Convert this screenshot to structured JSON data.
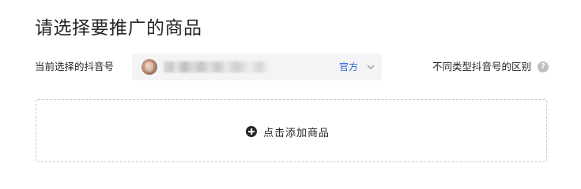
{
  "page": {
    "title": "请选择要推广的商品"
  },
  "account_row": {
    "label": "当前选择的抖音号",
    "selected_account": {
      "name_blurred": true,
      "badge": "官方"
    },
    "help_text": "不同类型抖音号的区别",
    "help_icon": "question-circle-icon"
  },
  "dropzone": {
    "label": "点击添加商品",
    "icon": "plus-circle-icon"
  },
  "colors": {
    "badge": "#2a63d9",
    "select_bg": "#f4f4f6",
    "border_dashed": "#c8c8c8"
  }
}
